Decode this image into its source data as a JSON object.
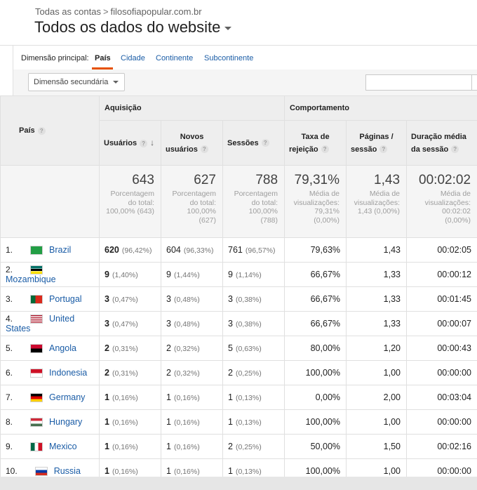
{
  "breadcrumb": {
    "account": "Todas as contas",
    "separator": ">",
    "property": "filosofiapopular.com.br"
  },
  "view_title": "Todos os dados do website",
  "dimension_bar": {
    "label": "Dimensão principal:",
    "active": "País",
    "links": [
      "Cidade",
      "Continente",
      "Subcontinente"
    ]
  },
  "secondary_dimension": "Dimensão secundária",
  "search": {
    "value": ""
  },
  "table": {
    "first_col": "País",
    "groups": {
      "acquisition": "Aquisição",
      "behavior": "Comportamento"
    },
    "columns": {
      "users": "Usuários",
      "new_users_1": "Novos",
      "new_users_2": "usuários",
      "sessions": "Sessões",
      "bounce_1": "Taxa de",
      "bounce_2": "rejeição",
      "pages_1": "Páginas /",
      "pages_2": "sessão",
      "duration_1": "Duração média",
      "duration_2": "da sessão"
    },
    "totals": {
      "users": {
        "value": "643",
        "l1": "Porcentagem",
        "l2": "do total:",
        "l3": "100,00% (643)"
      },
      "new_users": {
        "value": "627",
        "l1": "Porcentagem",
        "l2": "do total:",
        "l3": "100,00%",
        "l4": "(627)"
      },
      "sessions": {
        "value": "788",
        "l1": "Porcentagem",
        "l2": "do total:",
        "l3": "100,00%",
        "l4": "(788)"
      },
      "bounce": {
        "value": "79,31%",
        "l1": "Média de",
        "l2": "visualizações:",
        "l3": "79,31%",
        "l4": "(0,00%)"
      },
      "pages": {
        "value": "1,43",
        "l1": "Média de",
        "l2": "visualizações:",
        "l3": "1,43 (0,00%)"
      },
      "duration": {
        "value": "00:02:02",
        "l1": "Média de",
        "l2": "visualizações:",
        "l3": "00:02:02",
        "l4": "(0,00%)"
      }
    },
    "rows": [
      {
        "idx": "1.",
        "flag": "brazil-flag",
        "country": "Brazil",
        "users": "620",
        "users_pct": "(96,42%)",
        "new_users": "604",
        "new_users_pct": "(96,33%)",
        "sessions": "761",
        "sessions_pct": "(96,57%)",
        "bounce": "79,63%",
        "pages": "1,43",
        "duration": "00:02:05"
      },
      {
        "idx": "2.",
        "flag": "mozambique-flag",
        "country": "Mozambique",
        "users": "9",
        "users_pct": "(1,40%)",
        "new_users": "9",
        "new_users_pct": "(1,44%)",
        "sessions": "9",
        "sessions_pct": "(1,14%)",
        "bounce": "66,67%",
        "pages": "1,33",
        "duration": "00:00:12"
      },
      {
        "idx": "3.",
        "flag": "portugal-flag",
        "country": "Portugal",
        "users": "3",
        "users_pct": "(0,47%)",
        "new_users": "3",
        "new_users_pct": "(0,48%)",
        "sessions": "3",
        "sessions_pct": "(0,38%)",
        "bounce": "66,67%",
        "pages": "1,33",
        "duration": "00:01:45"
      },
      {
        "idx": "4.",
        "flag": "united-states-flag",
        "country": "United States",
        "users": "3",
        "users_pct": "(0,47%)",
        "new_users": "3",
        "new_users_pct": "(0,48%)",
        "sessions": "3",
        "sessions_pct": "(0,38%)",
        "bounce": "66,67%",
        "pages": "1,33",
        "duration": "00:00:07"
      },
      {
        "idx": "5.",
        "flag": "angola-flag",
        "country": "Angola",
        "users": "2",
        "users_pct": "(0,31%)",
        "new_users": "2",
        "new_users_pct": "(0,32%)",
        "sessions": "5",
        "sessions_pct": "(0,63%)",
        "bounce": "80,00%",
        "pages": "1,20",
        "duration": "00:00:43"
      },
      {
        "idx": "6.",
        "flag": "indonesia-flag",
        "country": "Indonesia",
        "users": "2",
        "users_pct": "(0,31%)",
        "new_users": "2",
        "new_users_pct": "(0,32%)",
        "sessions": "2",
        "sessions_pct": "(0,25%)",
        "bounce": "100,00%",
        "pages": "1,00",
        "duration": "00:00:00"
      },
      {
        "idx": "7.",
        "flag": "germany-flag",
        "country": "Germany",
        "users": "1",
        "users_pct": "(0,16%)",
        "new_users": "1",
        "new_users_pct": "(0,16%)",
        "sessions": "1",
        "sessions_pct": "(0,13%)",
        "bounce": "0,00%",
        "pages": "2,00",
        "duration": "00:03:04"
      },
      {
        "idx": "8.",
        "flag": "hungary-flag",
        "country": "Hungary",
        "users": "1",
        "users_pct": "(0,16%)",
        "new_users": "1",
        "new_users_pct": "(0,16%)",
        "sessions": "1",
        "sessions_pct": "(0,13%)",
        "bounce": "100,00%",
        "pages": "1,00",
        "duration": "00:00:00"
      },
      {
        "idx": "9.",
        "flag": "mexico-flag",
        "country": "Mexico",
        "users": "1",
        "users_pct": "(0,16%)",
        "new_users": "1",
        "new_users_pct": "(0,16%)",
        "sessions": "2",
        "sessions_pct": "(0,25%)",
        "bounce": "50,00%",
        "pages": "1,50",
        "duration": "00:02:16"
      },
      {
        "idx": "10.",
        "flag": "russia-flag",
        "country": "Russia",
        "users": "1",
        "users_pct": "(0,16%)",
        "new_users": "1",
        "new_users_pct": "(0,16%)",
        "sessions": "1",
        "sessions_pct": "(0,13%)",
        "bounce": "100,00%",
        "pages": "1,00",
        "duration": "00:00:00"
      }
    ]
  },
  "colors": {
    "link": "#1a5ca6",
    "accent": "#e65100",
    "header_bg": "#eeeeee"
  }
}
